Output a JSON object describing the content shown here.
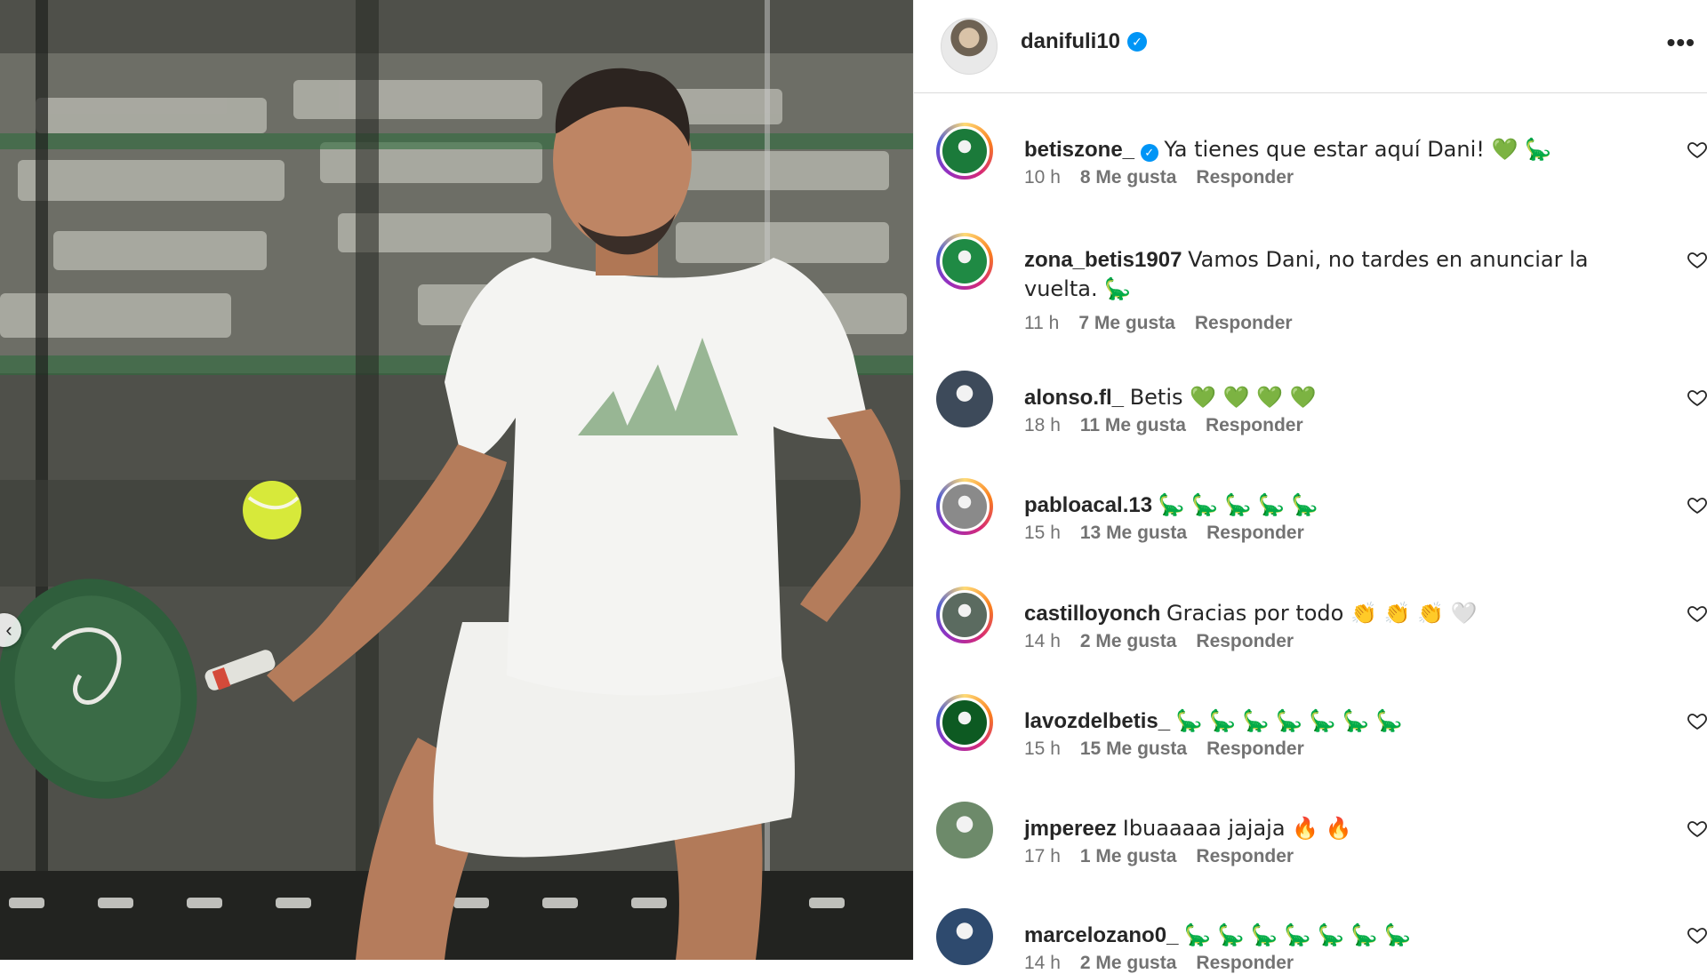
{
  "post": {
    "username": "danifuli10",
    "more_label": "•••",
    "prev_icon": "‹"
  },
  "comments": [
    {
      "user": "betiszone_",
      "verified": true,
      "text": "Ya tienes que estar aquí Dani! 💚 🦕",
      "time": "10 h",
      "likes": "8 Me gusta",
      "reply": "Responder",
      "avatar_color": "#1b7a3a"
    },
    {
      "user": "zona_betis1907",
      "verified": false,
      "text": "Vamos Dani, no tardes en anunciar la vuelta. 🦕",
      "time": "11 h",
      "likes": "7 Me gusta",
      "reply": "Responder",
      "avatar_color": "#1f8a44"
    },
    {
      "user": "alonso.fl_",
      "verified": false,
      "text": "Betis 💚 💚 💚 💚",
      "time": "18 h",
      "likes": "11 Me gusta",
      "reply": "Responder",
      "avatar_color": "#3d4a5a"
    },
    {
      "user": "pabloacal.13",
      "verified": false,
      "text": "🦕 🦕 🦕 🦕 🦕",
      "time": "15 h",
      "likes": "13 Me gusta",
      "reply": "Responder",
      "avatar_color": "#8a8a8a"
    },
    {
      "user": "castilloyonch",
      "verified": false,
      "text": "Gracias por todo 👏 👏 👏 🤍",
      "time": "14 h",
      "likes": "2 Me gusta",
      "reply": "Responder",
      "avatar_color": "#5b6b60"
    },
    {
      "user": "lavozdelbetis_",
      "verified": false,
      "text": "🦕 🦕 🦕 🦕 🦕 🦕 🦕",
      "time": "15 h",
      "likes": "15 Me gusta",
      "reply": "Responder",
      "avatar_color": "#0d5a22"
    },
    {
      "user": "jmpereez",
      "verified": false,
      "text": "Ibuaaaaa jajaja 🔥 🔥",
      "time": "17 h",
      "likes": "1 Me gusta",
      "reply": "Responder",
      "avatar_color": "#6d8a6a"
    },
    {
      "user": "marcelozano0_",
      "verified": false,
      "text": "🦕 🦕 🦕 🦕 🦕 🦕 🦕",
      "time": "14 h",
      "likes": "2 Me gusta",
      "reply": "Responder",
      "avatar_color": "#2e4a6e"
    }
  ],
  "colors": {
    "accent": "#0095f6",
    "text": "#262626",
    "muted": "#737373",
    "heart_green": "#2fb14f"
  }
}
